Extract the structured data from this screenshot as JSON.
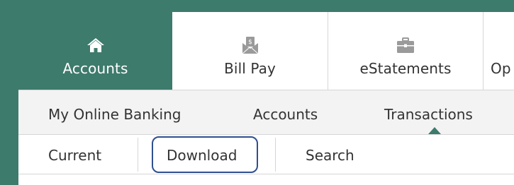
{
  "top_nav": [
    {
      "label": "Accounts",
      "icon": "home-icon",
      "active": true
    },
    {
      "label": "Bill Pay",
      "icon": "bill-pay-icon",
      "active": false
    },
    {
      "label": "eStatements",
      "icon": "briefcase-icon",
      "active": false
    },
    {
      "label": "Op",
      "icon": "",
      "active": false
    }
  ],
  "sub_nav": {
    "items": [
      "My Online Banking",
      "Accounts",
      "Transactions"
    ],
    "active": "Transactions"
  },
  "third_nav": {
    "items": [
      "Current",
      "Download",
      "Search"
    ],
    "highlighted": "Download"
  },
  "colors": {
    "accent": "#3d7b6c",
    "highlight_border": "#2f4f8f",
    "icon_gray": "#9a9a9a"
  }
}
